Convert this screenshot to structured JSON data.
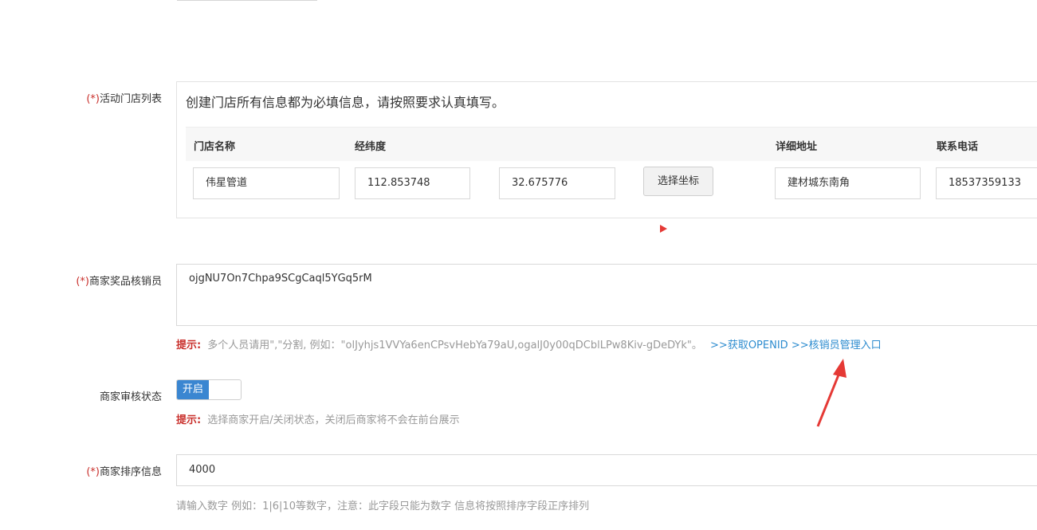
{
  "store_list": {
    "label_req": "(*)",
    "label": "活动门店列表",
    "notice": "创建门店所有信息都为必填信息，请按照要求认真填写。",
    "columns": {
      "name": "门店名称",
      "coords": "经纬度",
      "address": "详细地址",
      "phone": "联系电话"
    },
    "row": {
      "name": "伟星管道",
      "longitude": "112.853748",
      "latitude": "32.675776",
      "pick_coord_button": "选择坐标",
      "address": "建材城东南角",
      "phone": "18537359133"
    }
  },
  "verifier": {
    "label_req": "(*)",
    "label": "商家奖品核销员",
    "value": "ojgNU7On7Chpa9SCgCaql5YGq5rM",
    "hint_label": "提示:",
    "hint_text": "多个人员请用\",\"分割, 例如：\"olJyhjs1VVYa6enCPsvHebYa79aU,ogalJ0y00qDCblLPw8Kiv-gDeDYk\"。",
    "link_openid": ">>获取OPENID",
    "link_manage": ">>核销员管理入口"
  },
  "audit": {
    "label": "商家审核状态",
    "switch_label": "开启",
    "hint_label": "提示:",
    "hint_text": "选择商家开启/关闭状态，关闭后商家将不会在前台展示"
  },
  "sort": {
    "label_req": "(*)",
    "label": "商家排序信息",
    "value": "4000",
    "hint_text": "请输入数字 例如：1|6|10等数字，注意：此字段只能为数字 信息将按照排序字段正序排列"
  },
  "colors": {
    "required": "#c9302c",
    "link": "#2d8ccf",
    "switch_on": "#3a86d1",
    "arrow": "#e53935"
  }
}
